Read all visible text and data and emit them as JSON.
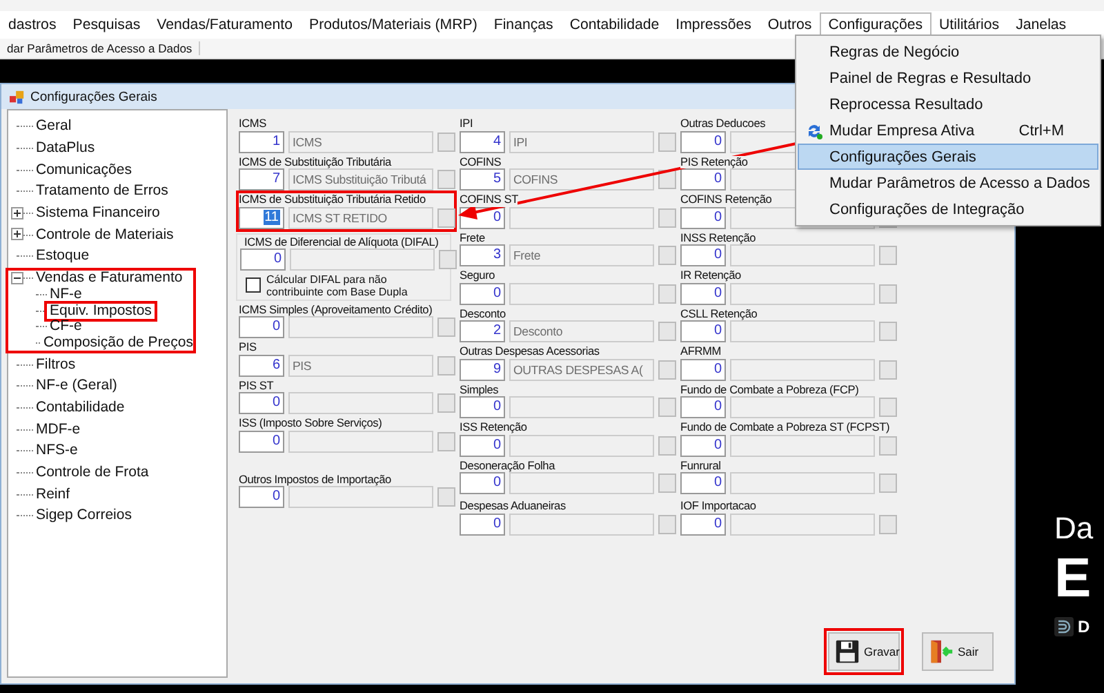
{
  "menu_bar": [
    {
      "label": "dastros",
      "selected": false
    },
    {
      "label": "Pesquisas",
      "selected": false
    },
    {
      "label": "Vendas/Faturamento",
      "selected": false
    },
    {
      "label": "Produtos/Materiais (MRP)",
      "selected": false
    },
    {
      "label": "Finanças",
      "selected": false
    },
    {
      "label": "Contabilidade",
      "selected": false
    },
    {
      "label": "Impressões",
      "selected": false
    },
    {
      "label": "Outros",
      "selected": false
    },
    {
      "label": "Configurações",
      "selected": true
    },
    {
      "label": "Utilitários",
      "selected": false
    },
    {
      "label": "Janelas",
      "selected": false
    }
  ],
  "toolbar": {
    "label": "dar Parâmetros de Acesso a Dados"
  },
  "menu": [
    {
      "label": "Regras de Negócio",
      "selected": false
    },
    {
      "label": "Painel de Regras e Resultado",
      "selected": false
    },
    {
      "label": "Reprocessa Resultado",
      "selected": false
    },
    {
      "label": "Mudar Empresa Ativa",
      "shortcut": "Ctrl+M",
      "kind": "icon",
      "selected": false
    },
    {
      "label": "Configurações Gerais",
      "selected": true
    },
    {
      "label": "Mudar Parâmetros de Acesso a Dados",
      "selected": false
    },
    {
      "label": "Configurações de Integração",
      "selected": false
    }
  ],
  "dialog": {
    "title": "Configurações Gerais",
    "tree": [
      {
        "label": "Geral"
      },
      {
        "label": "DataPlus"
      },
      {
        "label": "Comunicações"
      },
      {
        "label": "Tratamento de Erros"
      },
      {
        "label": "Sistema Financeiro",
        "expanded": false
      },
      {
        "label": "Controle de Materiais",
        "expanded": false
      },
      {
        "label": "Estoque"
      },
      {
        "label": "Vendas e Faturamento",
        "expanded": true,
        "highlighted": true,
        "children": [
          {
            "label": "NF-e"
          },
          {
            "label": "Equiv. Impostos",
            "highlighted": true
          },
          {
            "label": "CF-e"
          },
          {
            "label": "Composição de Preços"
          }
        ]
      },
      {
        "label": "Filtros"
      },
      {
        "label": "NF-e (Geral)"
      },
      {
        "label": "Contabilidade"
      },
      {
        "label": "MDF-e"
      },
      {
        "label": "NFS-e"
      },
      {
        "label": "Controle de Frota"
      },
      {
        "label": "Reinf"
      },
      {
        "label": "Sigep Correios"
      }
    ],
    "columns": [
      [
        {
          "kind": "field",
          "label": "ICMS",
          "code": "1",
          "description": "ICMS",
          "highlighted": false,
          "focused": false
        },
        {
          "kind": "field",
          "label": "ICMS de Substituição Tributária",
          "code": "7",
          "description": "ICMS Substituição Tributá",
          "highlighted": false,
          "focused": false
        },
        {
          "kind": "field",
          "label": "ICMS de Substituição Tributária Retido",
          "code": "11",
          "description": "ICMS ST RETIDO",
          "highlighted": true,
          "focused": true
        },
        {
          "kind": "group",
          "label": "ICMS de Diferencial de Alíquota (DIFAL)",
          "code": "0",
          "checkbox": {
            "label": "Cálcular DIFAL para não contribuinte com Base Dupla",
            "checked": false
          }
        },
        {
          "kind": "field",
          "label": "ICMS Simples (Aproveitamento Crédito)",
          "code": "0",
          "highlighted": false,
          "focused": false
        },
        {
          "kind": "field",
          "label": "PIS",
          "code": "6",
          "description": "PIS",
          "highlighted": false,
          "focused": false
        },
        {
          "kind": "field",
          "label": "PIS ST",
          "code": "0",
          "highlighted": false,
          "focused": false
        },
        {
          "kind": "field",
          "label": "ISS (Imposto Sobre Serviços)",
          "code": "0",
          "highlighted": false,
          "focused": false
        },
        {
          "kind": "field",
          "label": "Outros Impostos de Importação",
          "code": "0",
          "highlighted": false,
          "focused": false
        }
      ],
      [
        {
          "kind": "field",
          "label": "IPI",
          "code": "4",
          "description": "IPI",
          "highlighted": false,
          "focused": false
        },
        {
          "kind": "field",
          "label": "COFINS",
          "code": "5",
          "description": "COFINS",
          "highlighted": false,
          "focused": false
        },
        {
          "kind": "field",
          "label": "COFINS ST",
          "code": "0",
          "highlighted": false,
          "focused": false
        },
        {
          "kind": "field",
          "label": "Frete",
          "code": "3",
          "description": "Frete",
          "highlighted": false,
          "focused": false
        },
        {
          "kind": "field",
          "label": "Seguro",
          "code": "0",
          "highlighted": false,
          "focused": false
        },
        {
          "kind": "field",
          "label": "Desconto",
          "code": "2",
          "description": "Desconto",
          "highlighted": false,
          "focused": false
        },
        {
          "kind": "field",
          "label": "Outras Despesas Acessorias",
          "code": "9",
          "description": "OUTRAS DESPESAS A(",
          "highlighted": false,
          "focused": false
        },
        {
          "kind": "field",
          "label": "Simples",
          "code": "0",
          "highlighted": false,
          "focused": false
        },
        {
          "kind": "field",
          "label": "ISS Retenção",
          "code": "0",
          "highlighted": false,
          "focused": false
        },
        {
          "kind": "field",
          "label": "Desoneração Folha",
          "code": "0",
          "highlighted": false,
          "focused": false
        },
        {
          "kind": "field",
          "label": "Despesas Aduaneiras",
          "code": "0",
          "highlighted": false,
          "focused": false
        }
      ],
      [
        {
          "kind": "field",
          "label": "Outras Deducoes",
          "code": "0",
          "highlighted": false,
          "focused": false
        },
        {
          "kind": "field",
          "label": "PIS Retenção",
          "code": "0",
          "highlighted": false,
          "focused": false
        },
        {
          "kind": "field",
          "label": "COFINS Retenção",
          "code": "0",
          "highlighted": false,
          "focused": false
        },
        {
          "kind": "field",
          "label": "INSS Retenção",
          "code": "0",
          "highlighted": false,
          "focused": false
        },
        {
          "kind": "field",
          "label": "IR Retenção",
          "code": "0",
          "highlighted": false,
          "focused": false
        },
        {
          "kind": "field",
          "label": "CSLL Retenção",
          "code": "0",
          "highlighted": false,
          "focused": false
        },
        {
          "kind": "field",
          "label": "AFRMM",
          "code": "0",
          "highlighted": false,
          "focused": false
        },
        {
          "kind": "field",
          "label": "Fundo de Combate a Pobreza (FCP)",
          "code": "0",
          "highlighted": false,
          "focused": false
        },
        {
          "kind": "field",
          "label": "Fundo de Combate a Pobreza ST (FCPST)",
          "code": "0",
          "highlighted": false,
          "focused": false
        },
        {
          "kind": "field",
          "label": "Funrural",
          "code": "0",
          "highlighted": false,
          "focused": false
        },
        {
          "kind": "field",
          "label": "IOF Importacao",
          "code": "0",
          "highlighted": false,
          "focused": false
        }
      ]
    ],
    "buttons": [
      {
        "label": "Gravar",
        "kind": "save",
        "highlighted": true
      },
      {
        "label": "Sair",
        "kind": "exit",
        "highlighted": false
      }
    ]
  },
  "background": {
    "line_1": "Da",
    "line_2": "E",
    "line_3": "D"
  }
}
